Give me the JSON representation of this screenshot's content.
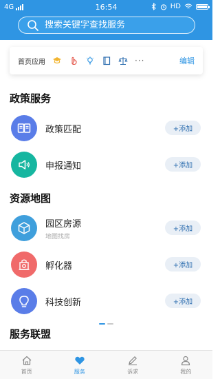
{
  "status_bar": {
    "network": "4G",
    "time": "16:54",
    "hd": "HD"
  },
  "search": {
    "placeholder": "搜索关键字查找服务"
  },
  "quick_apps": {
    "title": "首页应用",
    "icons": [
      "graduation-cap-icon",
      "hand-pointer-icon",
      "lightbulb-icon",
      "book-icon",
      "scale-icon"
    ],
    "more": "···",
    "edit_label": "编辑"
  },
  "sections": {
    "policy": {
      "title": "政策服务",
      "items": [
        {
          "label": "政策匹配",
          "icon": "open-book-icon",
          "color": "#5a7de8",
          "add_label": "+添加"
        },
        {
          "label": "申报通知",
          "icon": "megaphone-icon",
          "color": "#16b6a0",
          "add_label": "+添加"
        }
      ]
    },
    "resources": {
      "title": "资源地图",
      "items": [
        {
          "label": "园区房源",
          "sub": "地图找房",
          "icon": "cube-icon",
          "color": "#3f9fdc",
          "add_label": "+添加"
        },
        {
          "label": "孵化器",
          "icon": "incubator-icon",
          "color": "#f06a6a",
          "add_label": "+添加"
        },
        {
          "label": "科技创新",
          "icon": "bulb-icon",
          "color": "#5a7de8",
          "add_label": "+添加"
        }
      ]
    },
    "alliance": {
      "title": "服务联盟"
    }
  },
  "tabbar": [
    {
      "label": "首页",
      "icon": "home-icon",
      "active": false
    },
    {
      "label": "服务",
      "icon": "heart-icon",
      "active": true
    },
    {
      "label": "诉求",
      "icon": "pen-icon",
      "active": false
    },
    {
      "label": "我的",
      "icon": "user-icon",
      "active": false
    }
  ],
  "colors": {
    "primary": "#2f95e3",
    "add_button_bg": "#e9eff6"
  }
}
